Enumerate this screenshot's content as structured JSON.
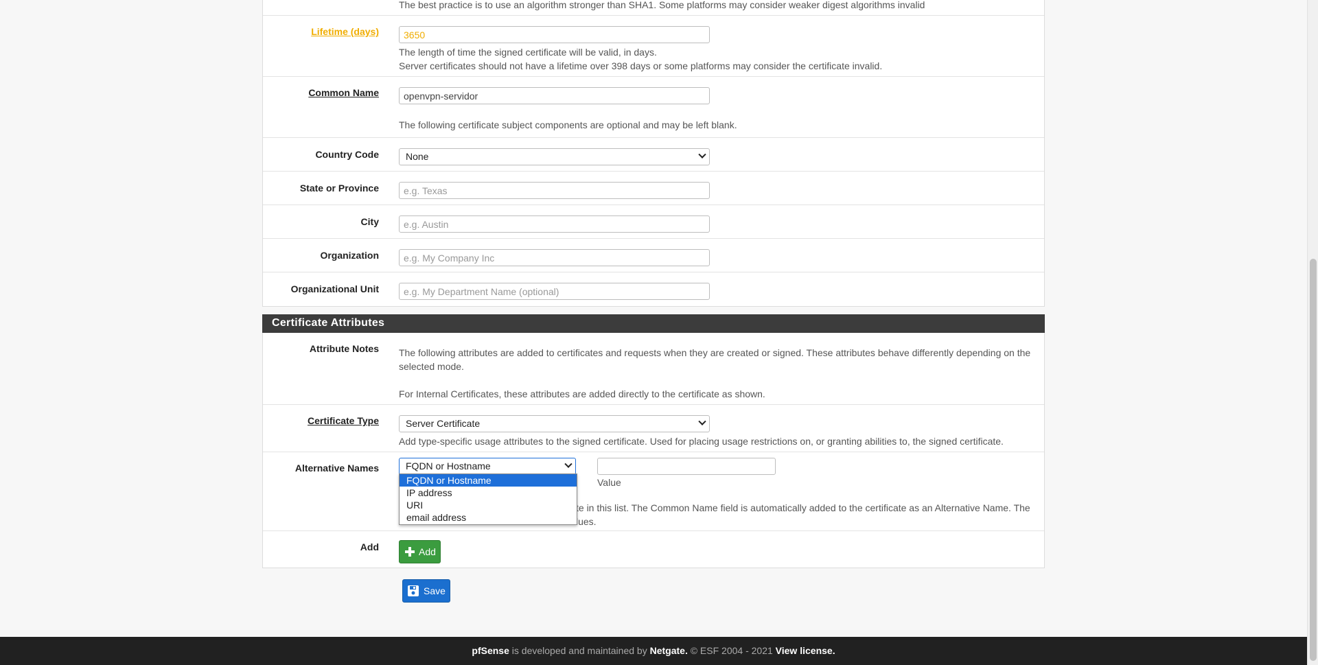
{
  "top_help": "The best practice is to use an algorithm stronger than SHA1. Some platforms may consider weaker digest algorithms invalid",
  "lifetime": {
    "label": "Lifetime (days)",
    "value": "3650",
    "help1": "The length of time the signed certificate will be valid, in days.",
    "help2": "Server certificates should not have a lifetime over 398 days or some platforms may consider the certificate invalid."
  },
  "common_name": {
    "label": "Common Name",
    "value": "openvpn-servidor"
  },
  "optional_note": "The following certificate subject components are optional and may be left blank.",
  "country_code": {
    "label": "Country Code",
    "value": "None"
  },
  "state": {
    "label": "State or Province",
    "placeholder": "e.g. Texas"
  },
  "city": {
    "label": "City",
    "placeholder": "e.g. Austin"
  },
  "organization": {
    "label": "Organization",
    "placeholder": "e.g. My Company Inc"
  },
  "org_unit": {
    "label": "Organizational Unit",
    "placeholder": "e.g. My Department Name (optional)"
  },
  "attributes": {
    "header": "Certificate Attributes",
    "notes_label": "Attribute Notes",
    "notes1a": "The following attributes are added to certificates and requests when they are created or signed. These attributes behave differently depending on the",
    "notes1b": "selected mode.",
    "notes2": "For Internal Certificates, these attributes are added directly to the certificate as shown."
  },
  "cert_type": {
    "label": "Certificate Type",
    "value": "Server Certificate",
    "help": "Add type-specific usage attributes to the signed certificate. Used for placing usage restrictions on, or granting abilities to, the signed certificate."
  },
  "alt_names": {
    "label": "Alternative Names",
    "type_value": "FQDN or Hostname",
    "value_label": "Value",
    "help_partial1": "te in this list. The Common Name field is automatically added to the certificate as an Alternative Name. The",
    "help_partial2": "lues.",
    "options": [
      "FQDN or Hostname",
      "IP address",
      "URI",
      "email address"
    ]
  },
  "add": {
    "label": "Add",
    "button": "Add"
  },
  "save_button": "Save",
  "footer": {
    "brand": "pfSense",
    "mid": " is developed and maintained by ",
    "company": "Netgate.",
    "copy": " © ESF 2004 - 2021 ",
    "license": "View license."
  }
}
